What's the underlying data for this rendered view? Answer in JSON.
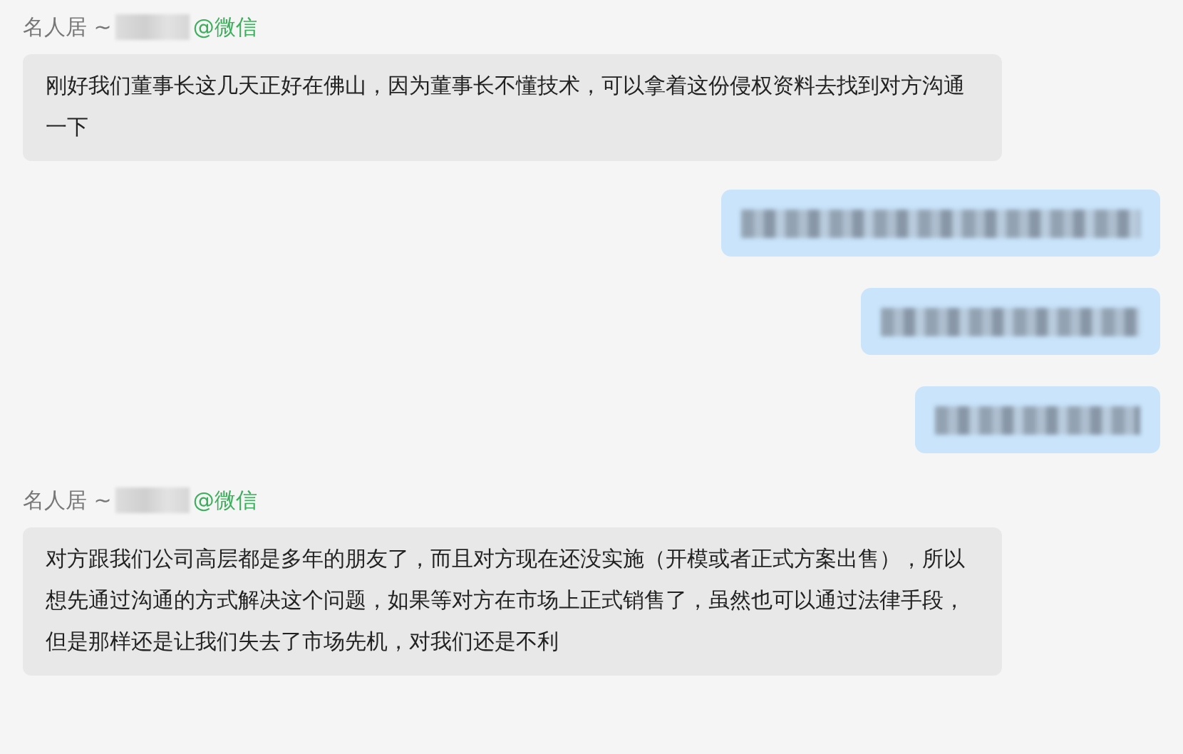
{
  "messages": [
    {
      "kind": "received",
      "sender": "名人居 ~",
      "source": "@微信",
      "text": "刚好我们董事长这几天正好在佛山，因为董事长不懂技术，可以拿着这份侵权资料去找到对方沟通一下"
    },
    {
      "kind": "sent-redacted"
    },
    {
      "kind": "sent-redacted"
    },
    {
      "kind": "sent-redacted"
    },
    {
      "kind": "received",
      "sender": "名人居 ~",
      "source": "@微信",
      "text": "对方跟我们公司高层都是多年的朋友了，而且对方现在还没实施（开模或者正式方案出售），所以想先通过沟通的方式解决这个问题，如果等对方在市场上正式销售了，虽然也可以通过法律手段，但是那样还是让我们失去了市场先机，对我们还是不利"
    }
  ]
}
